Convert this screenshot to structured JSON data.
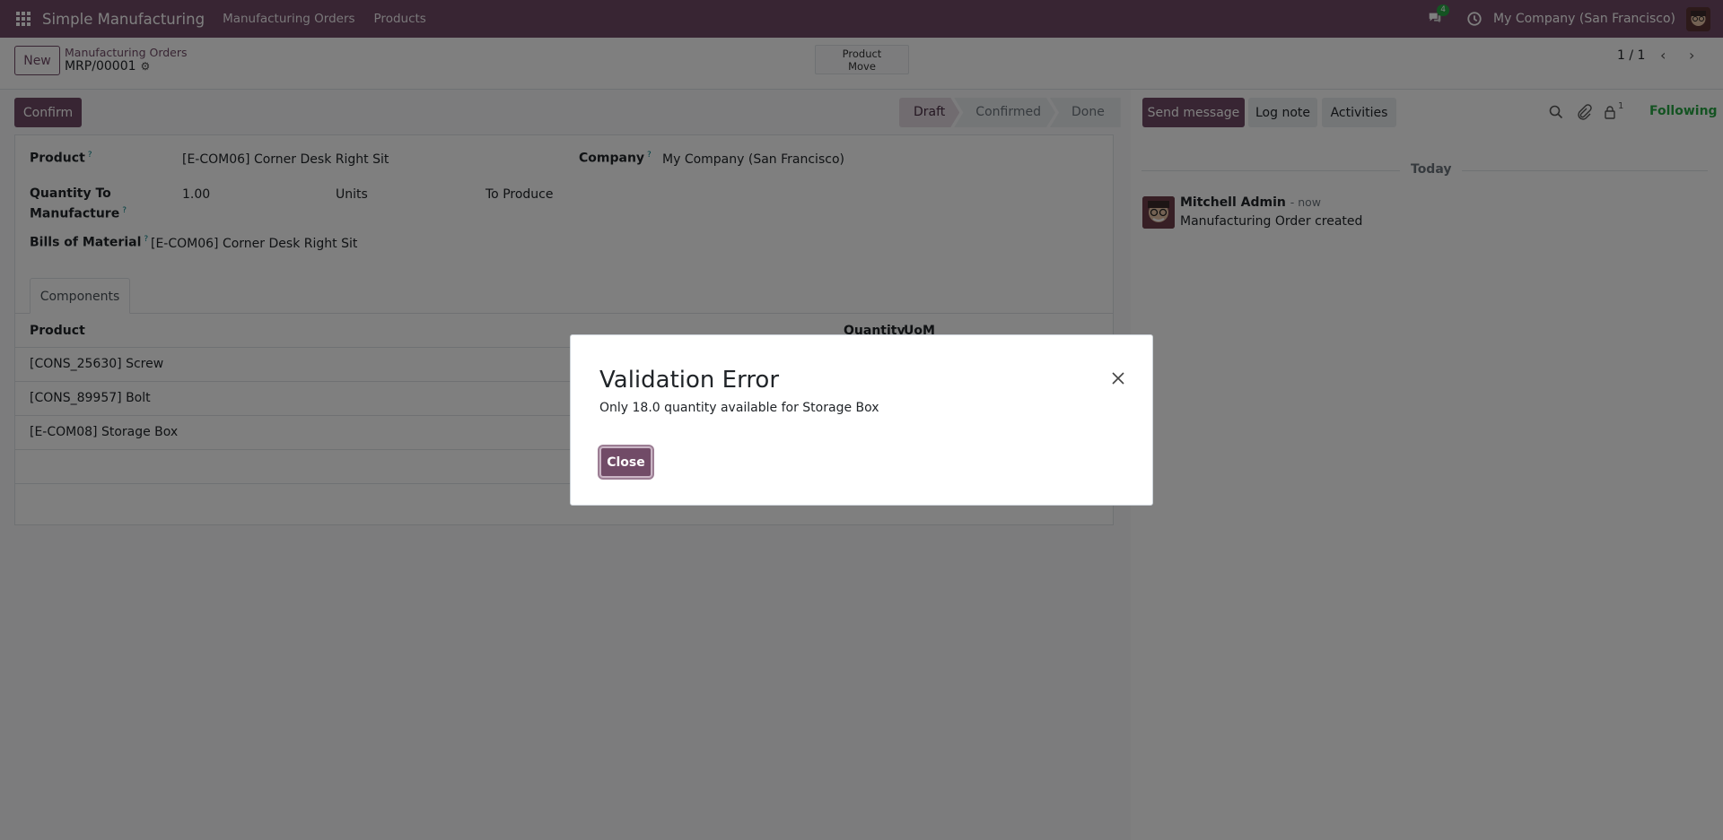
{
  "topbar": {
    "app_name": "Simple Manufacturing",
    "menu": [
      "Manufacturing Orders",
      "Products"
    ],
    "chat_count": "4",
    "company": "My Company (San Francisco)"
  },
  "control_panel": {
    "new_label": "New",
    "breadcrumb_parent": "Manufacturing Orders",
    "record_name": "MRP/00001",
    "smart_button_line1": "Product",
    "smart_button_line2": "Move",
    "pager": "1 / 1"
  },
  "statusbar": {
    "confirm_label": "Confirm",
    "stages": [
      "Draft",
      "Confirmed",
      "Done"
    ]
  },
  "form": {
    "product_label": "Product",
    "product_value": "[E-COM06] Corner Desk Right Sit",
    "company_label": "Company",
    "company_value": "My Company (San Francisco)",
    "qty_label_line1": "Quantity To",
    "qty_label_line2": "Manufacture",
    "qty_value": "1.00",
    "qty_uom": "Units",
    "qty_to_produce": "To Produce",
    "bom_label": "Bills of Material",
    "bom_value": "[E-COM06] Corner Desk Right Sit",
    "tab_components": "Components",
    "help_mark": "?"
  },
  "components_table": {
    "headers": [
      "Product",
      "Quantity",
      "UoM"
    ],
    "rows": [
      {
        "product": "[CONS_25630] Screw"
      },
      {
        "product": "[CONS_89957] Bolt"
      },
      {
        "product": "[E-COM08] Storage Box"
      }
    ]
  },
  "chatter": {
    "send_message": "Send message",
    "log_note": "Log note",
    "activities": "Activities",
    "followers_count": "1",
    "following": "Following",
    "date_separator": "Today",
    "message": {
      "author": "Mitchell Admin",
      "time": "- now",
      "body": "Manufacturing Order created"
    }
  },
  "dialog": {
    "title": "Validation Error",
    "message": "Only 18.0 quantity available for Storage Box",
    "close_label": "Close"
  },
  "colors": {
    "brand": "#714b67",
    "following": "#28a745"
  }
}
